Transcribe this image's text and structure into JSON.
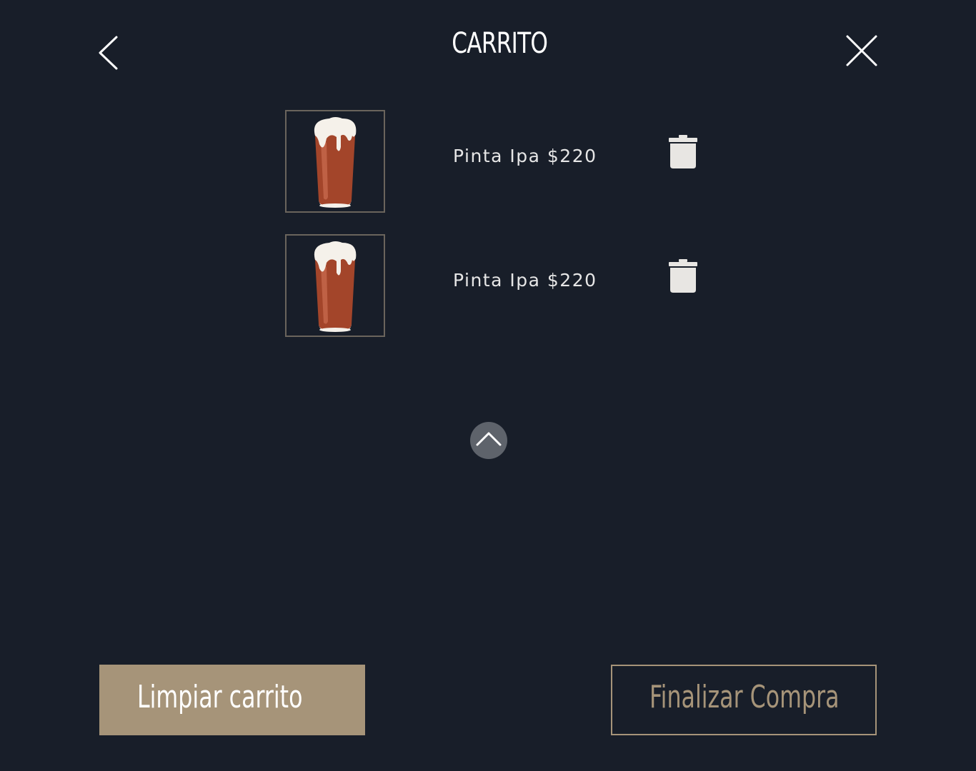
{
  "header": {
    "title": "CARRITO",
    "back_icon": "chevron-left-icon",
    "close_icon": "close-icon"
  },
  "cart": {
    "items": [
      {
        "label": "Pinta Ipa $220",
        "image": "beer-pint-icon",
        "remove_icon": "trash-icon"
      },
      {
        "label": "Pinta Ipa $220",
        "image": "beer-pint-icon",
        "remove_icon": "trash-icon"
      }
    ]
  },
  "scroll": {
    "icon": "chevron-up-icon"
  },
  "actions": {
    "clear_label": "Limpiar carrito",
    "finish_label": "Finalizar Compra"
  },
  "colors": {
    "background": "#181e29",
    "accent": "#a69479",
    "text": "#ffffff",
    "beer": "#a3452a",
    "foam": "#f5f1ea"
  }
}
